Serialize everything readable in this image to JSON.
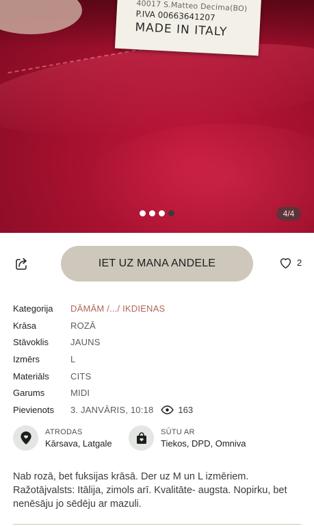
{
  "gallery": {
    "tag_lines": [
      "40017 S.Matteo Decima(BO)",
      "P.IVA 00663641207",
      "MADE IN ITALY"
    ],
    "dots_total": 4,
    "active_index": 3,
    "counter": "4/4"
  },
  "actions": {
    "cta_label": "IET UZ MANA ANDELE",
    "likes": "2"
  },
  "details": {
    "category_label": "Kategorija",
    "category_value": "DĀMĀM /.../ IKDIENAS",
    "color_label": "Krāsa",
    "color_value": "ROZĀ",
    "condition_label": "Stāvoklis",
    "condition_value": "JAUNS",
    "size_label": "Izmērs",
    "size_value": "L",
    "material_label": "Materiāls",
    "material_value": "CITS",
    "length_label": "Garums",
    "length_value": "MIDI",
    "added_label": "Pievienots",
    "added_value": "3. JANVĀRIS, 10:18",
    "views": "163"
  },
  "location": {
    "label": "ATRODAS",
    "value": "Kārsava, Latgale"
  },
  "shipping": {
    "label": "SŪTU AR",
    "value": "Tiekos, DPD, Omniva"
  },
  "description": "Nab rozā, bet fuksijas krāsā. Der uz M un L izmēriem. Ražotājvalsts: Itālija, zimols arī. Kvalitāte- augsta. Nopirku, bet nenēsāju jo sēdēju ar mazuli.",
  "colors": {
    "accent_link": "#b06457",
    "cta_bg": "#cec7bb",
    "icon_circle": "#e4e6e3"
  }
}
